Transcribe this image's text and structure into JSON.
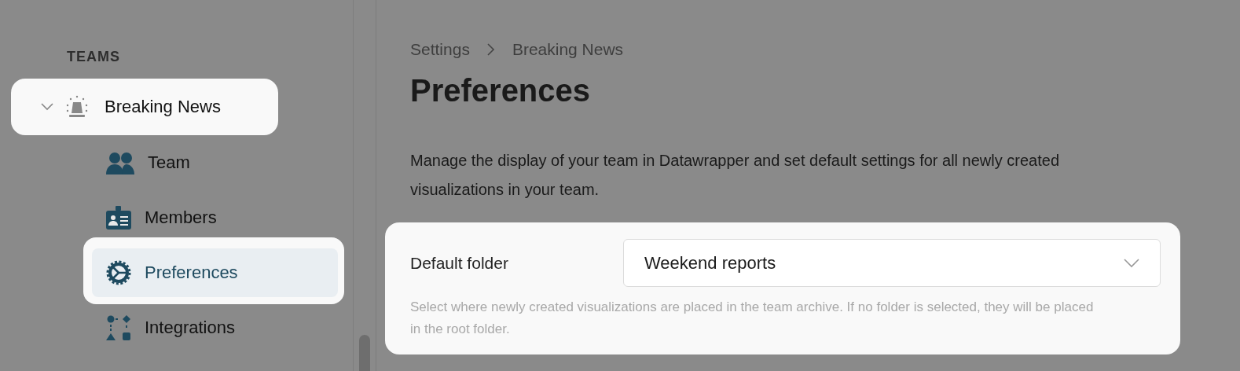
{
  "sidebar": {
    "section_title": "TEAMS",
    "teams": [
      {
        "label": "Breaking News",
        "expanded": true,
        "highlighted": true,
        "children": [
          {
            "label": "Team",
            "selected": false,
            "highlighted": false
          },
          {
            "label": "Members",
            "selected": false,
            "highlighted": false
          },
          {
            "label": "Preferences",
            "selected": true,
            "highlighted": true
          },
          {
            "label": "Integrations",
            "selected": false,
            "highlighted": false
          }
        ]
      }
    ]
  },
  "breadcrumb": [
    "Settings",
    "Breaking News"
  ],
  "page_title": "Preferences",
  "description": "Manage the display of your team in Datawrapper and set default settings for all newly created visualizations in your team.",
  "default_folder": {
    "label": "Default folder",
    "value": "Weekend reports",
    "hint": "Select where newly created visualizations are placed in the team archive. If no folder is selected, they will be placed in the root folder.",
    "highlighted": true
  }
}
